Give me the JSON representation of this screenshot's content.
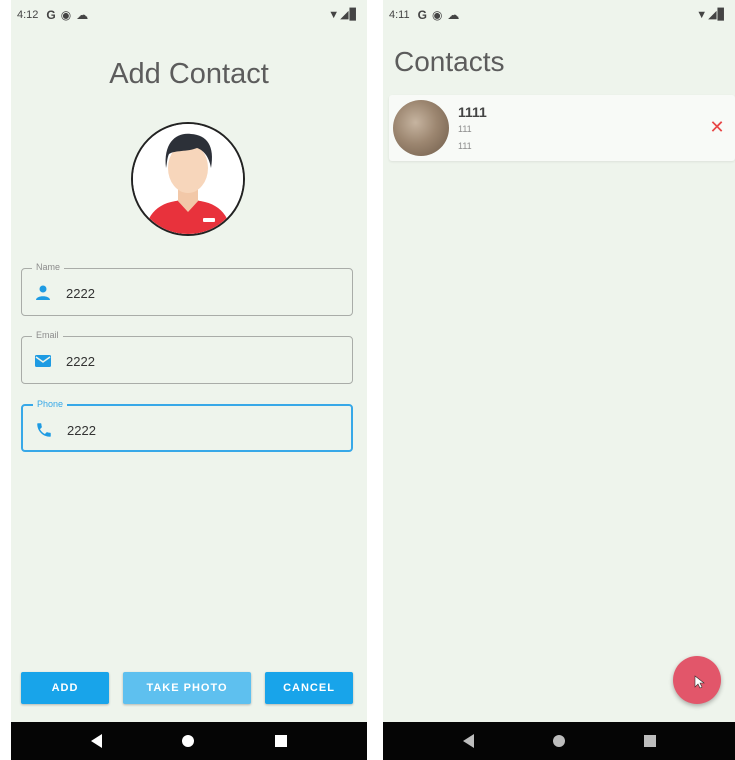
{
  "left_screen": {
    "status": {
      "time": "4:12",
      "icons": [
        "G",
        "◉",
        "☁"
      ],
      "right_icons": "▼◢▊"
    },
    "title": "Add Contact",
    "fields": [
      {
        "label": "Name",
        "value": "2222",
        "icon": "person-icon"
      },
      {
        "label": "Email",
        "value": "2222",
        "icon": "mail-icon"
      },
      {
        "label": "Phone",
        "value": "2222",
        "icon": "phone-icon",
        "focused": true
      }
    ],
    "buttons": {
      "add": "ADD",
      "take_photo": "TAKE PHOTO",
      "cancel": "CANCEL"
    },
    "accent_color": "#18a4ea"
  },
  "right_screen": {
    "status": {
      "time": "4:11",
      "icons": [
        "G",
        "◉",
        "☁"
      ],
      "right_icons": "▼◢▊"
    },
    "title": "Contacts",
    "contacts": [
      {
        "name": "1111",
        "email": "111",
        "phone": "111"
      }
    ],
    "delete_glyph": "✕",
    "fab_color": "#e2566a"
  }
}
